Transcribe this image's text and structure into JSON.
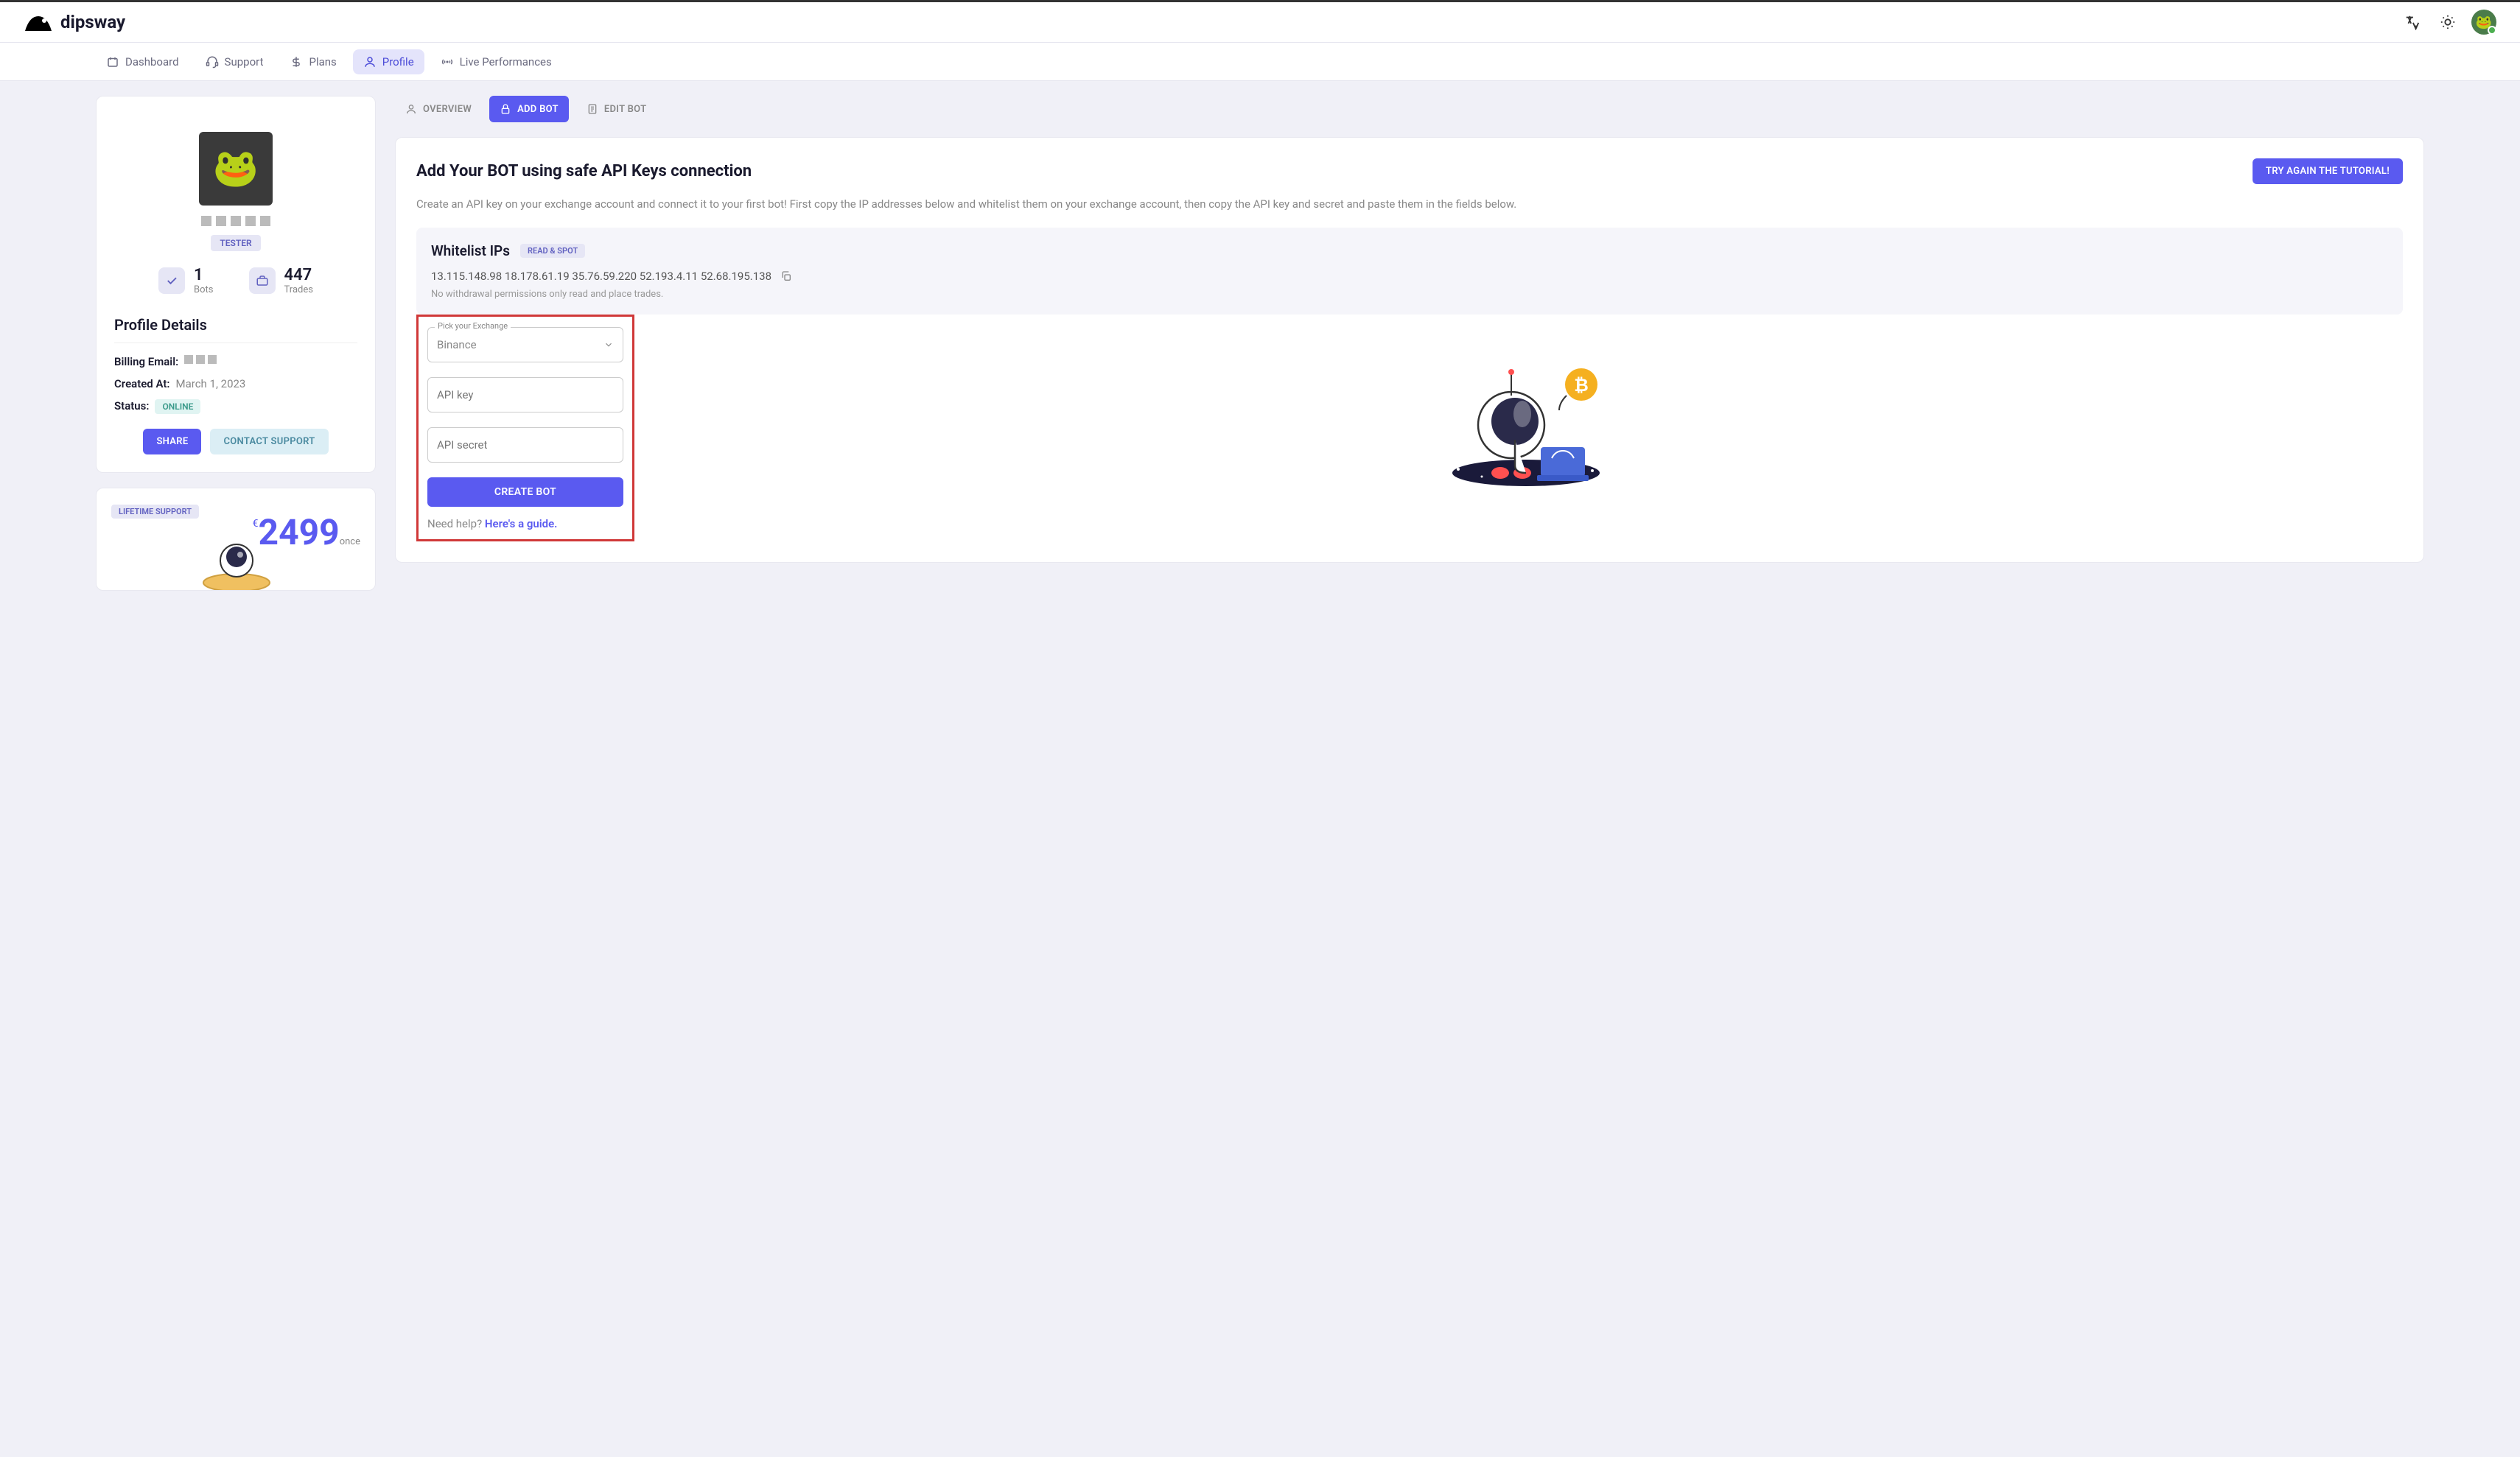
{
  "brand": "dipsway",
  "nav": {
    "dashboard": "Dashboard",
    "support": "Support",
    "plans": "Plans",
    "profile": "Profile",
    "live": "Live Performances"
  },
  "profile": {
    "badge": "TESTER",
    "bots_count": "1",
    "bots_label": "Bots",
    "trades_count": "447",
    "trades_label": "Trades",
    "details_heading": "Profile Details",
    "billing_label": "Billing Email:",
    "created_label": "Created At:",
    "created_val": "March 1, 2023",
    "status_label": "Status:",
    "status_val": "ONLINE",
    "share_btn": "SHARE",
    "contact_btn": "CONTACT SUPPORT"
  },
  "lifetime": {
    "badge": "LIFETIME SUPPORT",
    "currency": "€",
    "price": "2499",
    "suffix": "once"
  },
  "tabs": {
    "overview": "OVERVIEW",
    "addbot": "ADD BOT",
    "editbot": "EDIT BOT"
  },
  "addbot": {
    "title": "Add Your BOT using safe API Keys connection",
    "tutorial_btn": "TRY AGAIN THE TUTORIAL!",
    "desc": "Create an API key on your exchange account and connect it to your first bot! First copy the IP addresses below and whitelist them on your exchange account, then copy the API key and secret and paste them in the fields below.",
    "whitelist_title": "Whitelist IPs",
    "whitelist_badge": "READ & SPOT",
    "ips": "13.115.148.98 18.178.61.19 35.76.59.220 52.193.4.11 52.68.195.138",
    "ip_note": "No withdrawal permissions only read and place trades.",
    "exchange_label": "Pick your Exchange",
    "exchange_val": "Binance",
    "apikey_placeholder": "API key",
    "apisecret_placeholder": "API secret",
    "create_btn": "CREATE BOT",
    "help_text": "Need help? ",
    "help_link": "Here's a guide."
  }
}
